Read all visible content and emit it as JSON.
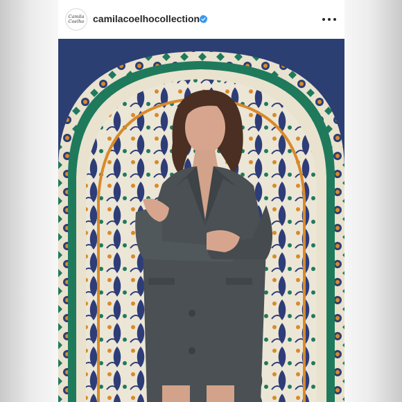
{
  "post": {
    "username": "camilacoelhocollection",
    "avatar_text": [
      "Camila",
      "Coelho"
    ],
    "verified_icon": "verified-badge-icon",
    "more_icon": "more-options-icon",
    "colors": {
      "verified_blue": "#3897f0",
      "tile_blue": "#2c3f73",
      "tile_green": "#1f7a5c",
      "tile_orange": "#d98a2a",
      "blazer": "#4a5053"
    }
  }
}
